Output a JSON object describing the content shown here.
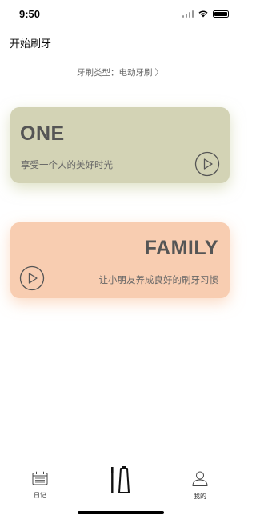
{
  "status_bar": {
    "time": "9:50"
  },
  "header": {
    "title": "开始刷牙",
    "brush_type_label": "牙刷类型：电动牙刷",
    "brush_type_chevron": "〉"
  },
  "cards": [
    {
      "title": "ONE",
      "subtitle": "享受一个人的美好时光",
      "color": "#d3d3b5",
      "icon": "play-circle-icon"
    },
    {
      "title": "FAMILY",
      "subtitle": "让小朋友养成良好的刷牙习惯",
      "color": "#f8cdb1",
      "icon": "play-circle-icon"
    }
  ],
  "tab_bar": {
    "tabs": [
      {
        "label": "日记",
        "icon": "calendar-icon"
      },
      {
        "label": "",
        "icon": "toothbrush-toothpaste-icon",
        "selected": true
      },
      {
        "label": "我的",
        "icon": "person-icon"
      }
    ]
  }
}
